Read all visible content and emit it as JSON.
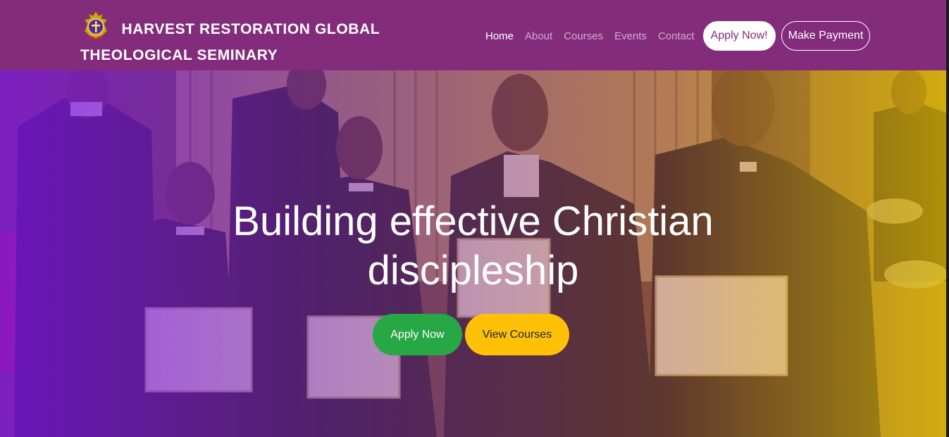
{
  "header": {
    "brand_line1": "HARVEST RESTORATION GLOBAL",
    "brand_line2": "THEOLOGICAL SEMINARY",
    "logo_icon": "seminary-crest-icon",
    "background_color": "#842c7c"
  },
  "nav": {
    "items": [
      {
        "label": "Home",
        "active": true
      },
      {
        "label": "About",
        "active": false
      },
      {
        "label": "Courses",
        "active": false
      },
      {
        "label": "Events",
        "active": false
      },
      {
        "label": "Contact",
        "active": false
      }
    ],
    "apply_label": "Apply Now!",
    "payment_label": "Make Payment"
  },
  "hero": {
    "title_line1": "Building effective Christian",
    "title_line2": "discipleship",
    "apply_label": "Apply Now",
    "courses_label": "View Courses",
    "apply_color": "#28a745",
    "courses_color": "#ffc107",
    "image_description_icon": "graduation-photo"
  }
}
